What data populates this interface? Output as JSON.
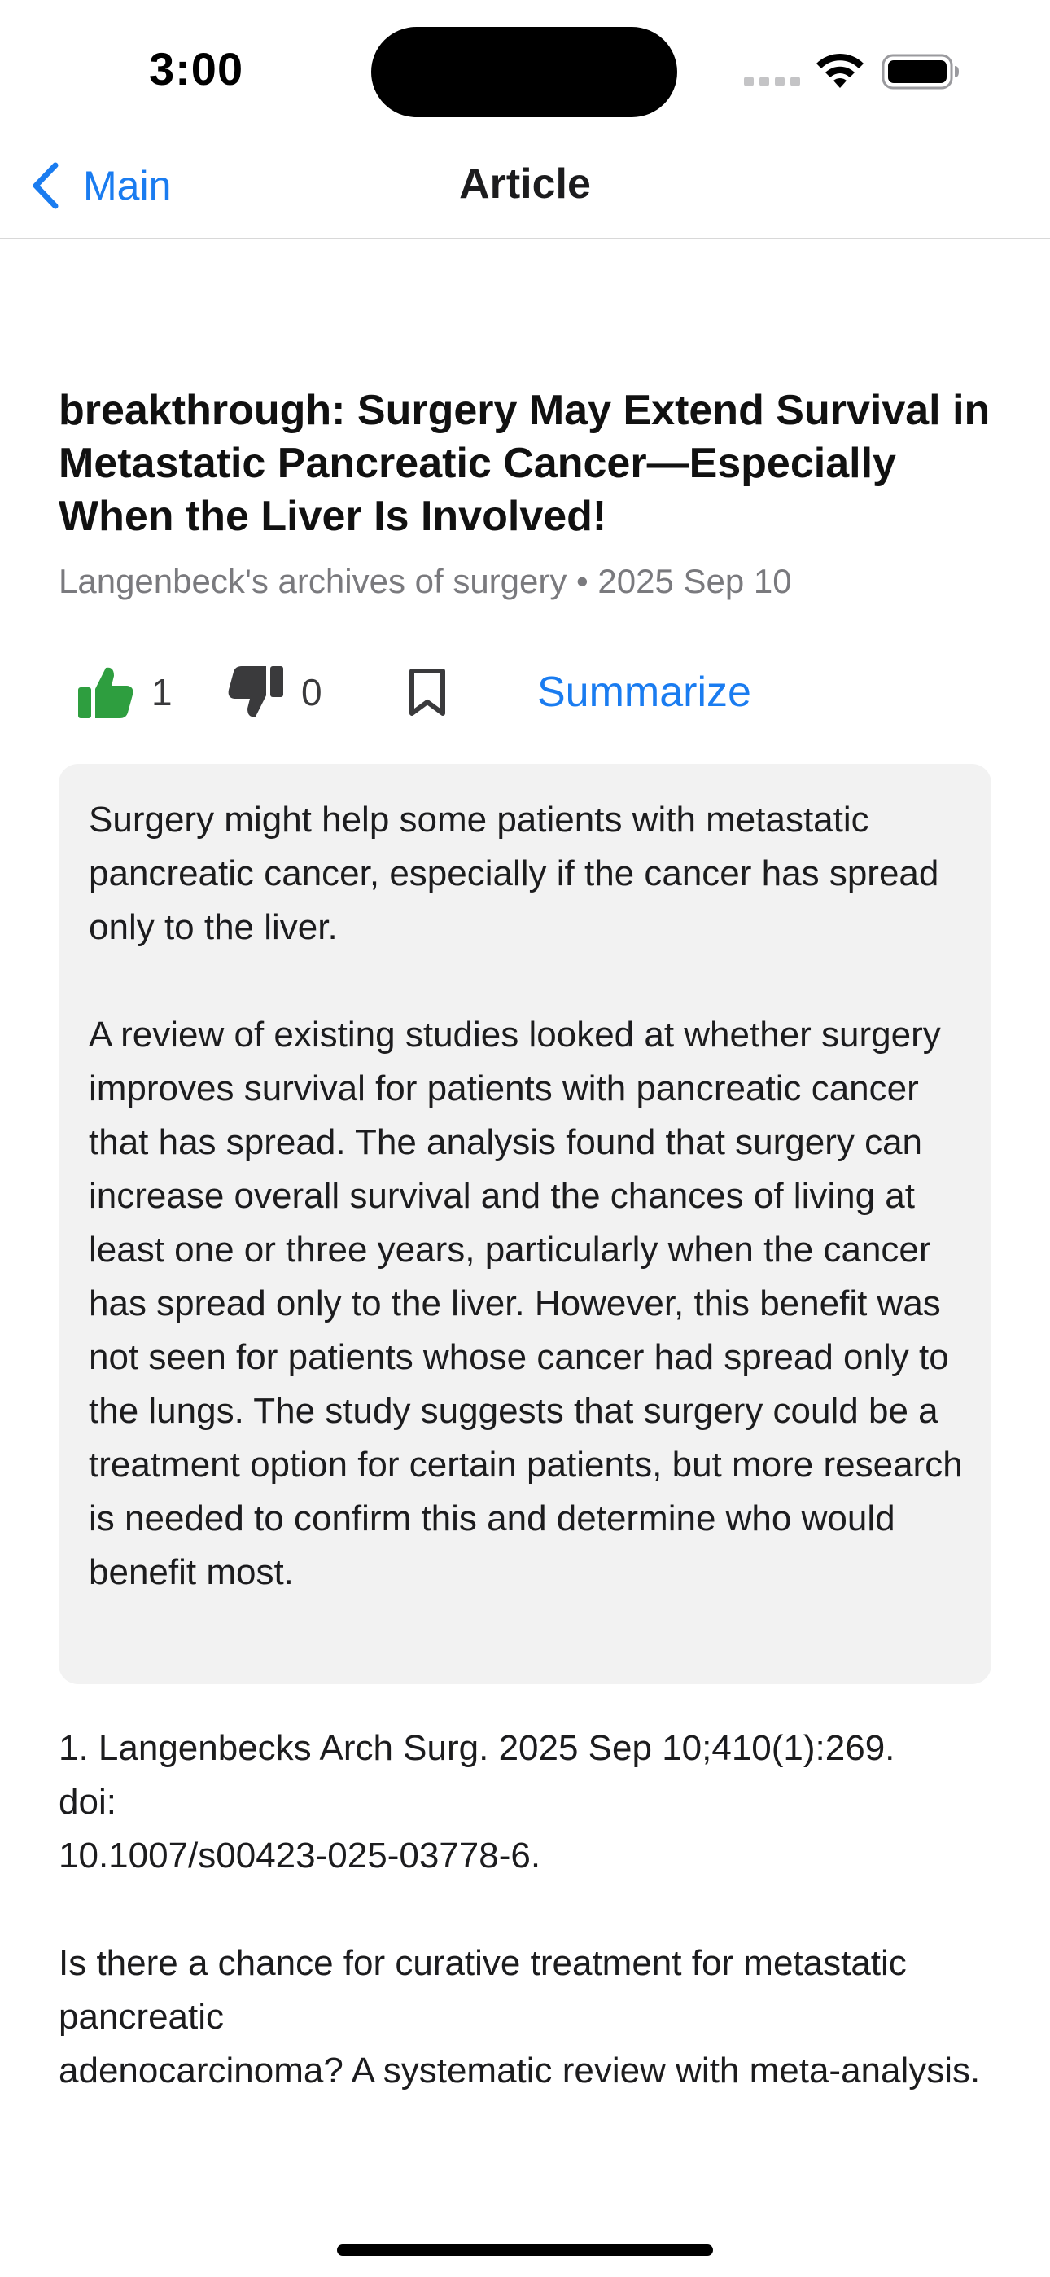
{
  "status_bar": {
    "time": "3:00"
  },
  "nav": {
    "back_label": "Main",
    "title": "Article"
  },
  "article": {
    "title": "breakthrough: Surgery May Extend Survival in Metastatic Pancreatic Cancer—Especially When the Liver Is Involved!",
    "meta": "Langenbeck's archives of surgery • 2025 Sep 10"
  },
  "actions": {
    "likes": "1",
    "dislikes": "0",
    "summarize_label": "Summarize",
    "like_color": "#2e9e3f",
    "accent_color": "#1a7cf0"
  },
  "summary": {
    "text": "Surgery might help some patients with metastatic pancreatic cancer, especially if the cancer has spread only to the liver.\n\nA review of existing studies looked at whether surgery improves survival for patients with pancreatic cancer that has spread. The analysis found that surgery can increase overall survival and the chances of living at least one or three years, particularly when the cancer has spread only to the liver. However, this benefit was not seen for patients whose cancer had spread only to the lungs. The study suggests that surgery could be a treatment option for certain patients, but more research is needed to confirm this and determine who would benefit most."
  },
  "citation": {
    "text": "1. Langenbecks Arch Surg. 2025 Sep 10;410(1):269.\ndoi:\n10.1007/s00423-025-03778-6.\n\nIs there a chance for curative treatment for metastatic pancreatic\nadenocarcinoma? A systematic review with meta-analysis."
  },
  "icons": {
    "signal": "cellular-signal-icon",
    "wifi": "wifi-icon",
    "battery": "battery-icon",
    "back": "chevron-left-icon",
    "like": "thumbs-up-icon",
    "dislike": "thumbs-down-icon",
    "bookmark": "bookmark-icon"
  }
}
